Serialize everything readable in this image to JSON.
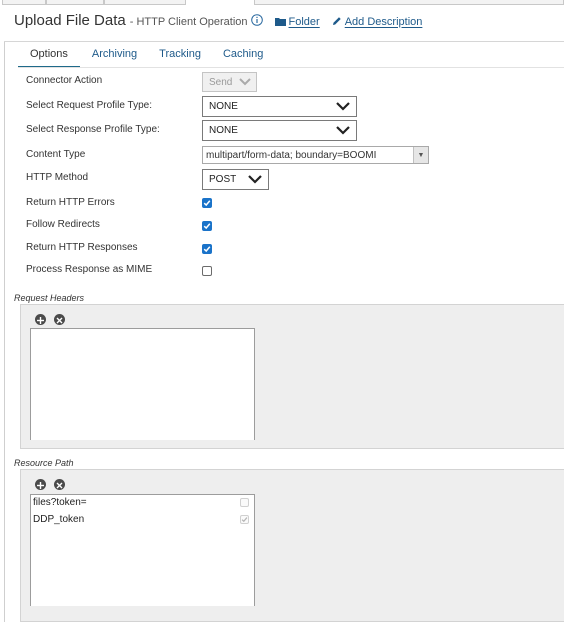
{
  "header": {
    "title": "Upload File Data",
    "subtitle": "- HTTP Client Operation",
    "folder_link": "Folder",
    "description_link": "Add Description"
  },
  "tabs": [
    {
      "label": "Options",
      "active": true
    },
    {
      "label": "Archiving",
      "active": false
    },
    {
      "label": "Tracking",
      "active": false
    },
    {
      "label": "Caching",
      "active": false
    }
  ],
  "form": {
    "connector_action": {
      "label": "Connector Action",
      "value": "Send",
      "disabled": true
    },
    "request_profile_type": {
      "label": "Select Request Profile Type:",
      "value": "NONE"
    },
    "response_profile_type": {
      "label": "Select Response Profile Type:",
      "value": "NONE"
    },
    "content_type": {
      "label": "Content Type",
      "value": "multipart/form-data; boundary=BOOMI"
    },
    "http_method": {
      "label": "HTTP Method",
      "value": "POST"
    },
    "return_http_errors": {
      "label": "Return HTTP Errors",
      "checked": true
    },
    "follow_redirects": {
      "label": "Follow Redirects",
      "checked": true
    },
    "return_http_responses": {
      "label": "Return HTTP Responses",
      "checked": true
    },
    "process_response_mime": {
      "label": "Process Response as MIME",
      "checked": false
    }
  },
  "request_headers": {
    "label": "Request Headers",
    "rows": []
  },
  "resource_path": {
    "label": "Resource Path",
    "rows": [
      {
        "value": "files?token=",
        "is_variable": false
      },
      {
        "value": "DDP_token",
        "is_variable": true
      }
    ]
  },
  "colors": {
    "link": "#1e5a8a",
    "checkbox_checked": "#1a73c9",
    "panel_bg": "#eeeeee",
    "active_tab_underline": "#1e6a8a"
  },
  "icons": {
    "info": "info-circle-icon",
    "folder": "folder-icon",
    "edit": "pencil-icon",
    "add": "plus-circle-icon",
    "remove": "x-circle-icon",
    "dropdown": "chevron-down-icon"
  }
}
